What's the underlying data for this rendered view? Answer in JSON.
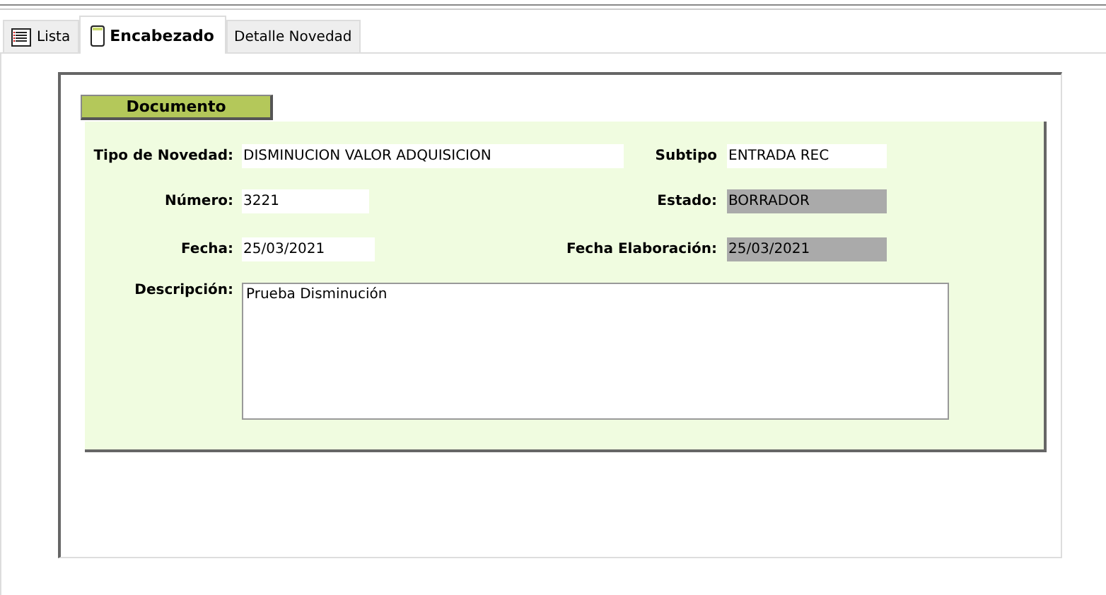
{
  "tabs": [
    {
      "label": "Lista",
      "selected": false
    },
    {
      "label": "Encabezado",
      "selected": true
    },
    {
      "label": "Detalle Novedad",
      "selected": false
    }
  ],
  "section": {
    "title": "Documento"
  },
  "rows": [
    {
      "left": {
        "label": "Tipo de Novedad:",
        "value": "DISMINUCION VALOR ADQUISICION",
        "readonly": false
      },
      "right": {
        "label": "Subtipo",
        "value": "ENTRADA REC",
        "readonly": false
      }
    },
    {
      "left": {
        "label": "Número:",
        "value": "3221",
        "readonly": false
      },
      "right": {
        "label": "Estado:",
        "value": "BORRADOR",
        "readonly": true
      }
    },
    {
      "left": {
        "label": "Fecha:",
        "value": "25/03/2021",
        "readonly": false
      },
      "right": {
        "label": "Fecha Elaboración:",
        "value": "25/03/2021",
        "readonly": true
      }
    }
  ],
  "description": {
    "label": "Descripción:",
    "value": "Prueba Disminución"
  }
}
